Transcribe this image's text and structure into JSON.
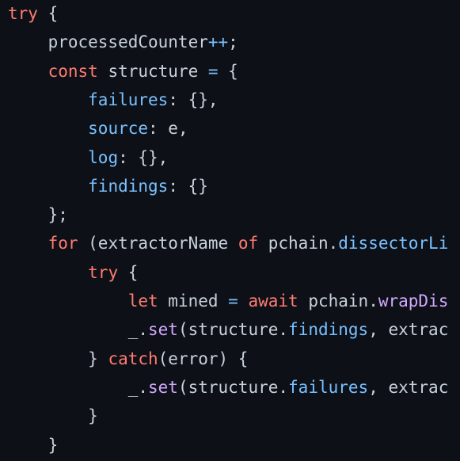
{
  "code": {
    "lines": [
      [
        {
          "t": "kw",
          "v": "try"
        },
        {
          "t": "plain",
          "v": " {"
        }
      ],
      [
        {
          "t": "plain",
          "v": "    processedCounter"
        },
        {
          "t": "op",
          "v": "++"
        },
        {
          "t": "plain",
          "v": ";"
        }
      ],
      [
        {
          "t": "plain",
          "v": "    "
        },
        {
          "t": "kw",
          "v": "const"
        },
        {
          "t": "plain",
          "v": " structure "
        },
        {
          "t": "op",
          "v": "="
        },
        {
          "t": "plain",
          "v": " {"
        }
      ],
      [
        {
          "t": "plain",
          "v": "        "
        },
        {
          "t": "prop",
          "v": "failures"
        },
        {
          "t": "plain",
          "v": ": {},"
        }
      ],
      [
        {
          "t": "plain",
          "v": "        "
        },
        {
          "t": "prop",
          "v": "source"
        },
        {
          "t": "plain",
          "v": ": e,"
        }
      ],
      [
        {
          "t": "plain",
          "v": "        "
        },
        {
          "t": "prop",
          "v": "log"
        },
        {
          "t": "plain",
          "v": ": {},"
        }
      ],
      [
        {
          "t": "plain",
          "v": "        "
        },
        {
          "t": "prop",
          "v": "findings"
        },
        {
          "t": "plain",
          "v": ": {}"
        }
      ],
      [
        {
          "t": "plain",
          "v": "    };"
        }
      ],
      [
        {
          "t": "plain",
          "v": "    "
        },
        {
          "t": "kw",
          "v": "for"
        },
        {
          "t": "plain",
          "v": " (extractorName "
        },
        {
          "t": "kw",
          "v": "of"
        },
        {
          "t": "plain",
          "v": " pchain."
        },
        {
          "t": "prop",
          "v": "dissectorLi"
        }
      ],
      [
        {
          "t": "plain",
          "v": "        "
        },
        {
          "t": "kw",
          "v": "try"
        },
        {
          "t": "plain",
          "v": " {"
        }
      ],
      [
        {
          "t": "plain",
          "v": "            "
        },
        {
          "t": "kw",
          "v": "let"
        },
        {
          "t": "plain",
          "v": " mined "
        },
        {
          "t": "op",
          "v": "="
        },
        {
          "t": "plain",
          "v": " "
        },
        {
          "t": "kw",
          "v": "await"
        },
        {
          "t": "plain",
          "v": " pchain."
        },
        {
          "t": "fn",
          "v": "wrapDis"
        }
      ],
      [
        {
          "t": "plain",
          "v": "            _."
        },
        {
          "t": "fn",
          "v": "set"
        },
        {
          "t": "plain",
          "v": "(structure."
        },
        {
          "t": "prop",
          "v": "findings"
        },
        {
          "t": "plain",
          "v": ", extrac"
        }
      ],
      [
        {
          "t": "plain",
          "v": "        } "
        },
        {
          "t": "kw",
          "v": "catch"
        },
        {
          "t": "plain",
          "v": "(error) {"
        }
      ],
      [
        {
          "t": "plain",
          "v": "            _."
        },
        {
          "t": "fn",
          "v": "set"
        },
        {
          "t": "plain",
          "v": "(structure."
        },
        {
          "t": "prop",
          "v": "failures"
        },
        {
          "t": "plain",
          "v": ", extrac"
        }
      ],
      [
        {
          "t": "plain",
          "v": "        }"
        }
      ],
      [
        {
          "t": "plain",
          "v": "    }"
        }
      ]
    ]
  }
}
